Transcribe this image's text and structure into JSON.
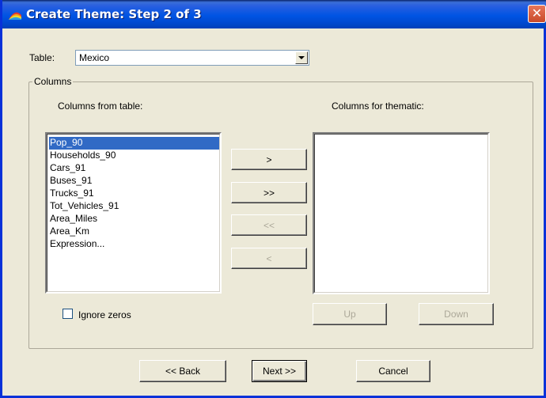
{
  "window": {
    "title": "Create Theme: Step 2 of 3",
    "close_symbol": "✕"
  },
  "table": {
    "label": "Table:",
    "selected": "Mexico"
  },
  "columns_group": {
    "title": "Columns",
    "from_label": "Columns from table:",
    "for_label": "Columns for thematic:",
    "from_items": [
      "Pop_90",
      "Households_90",
      "Cars_91",
      "Buses_91",
      "Trucks_91",
      "Tot_Vehicles_91",
      "Area_Miles",
      "Area_Km",
      "Expression..."
    ],
    "selected_item": "Pop_90",
    "for_items": []
  },
  "move_buttons": {
    "add": ">",
    "add_all": ">>",
    "remove_all": "<<",
    "remove": "<"
  },
  "ignore_zeros": {
    "label": "Ignore zeros",
    "checked": false
  },
  "order_buttons": {
    "up": "Up",
    "down": "Down"
  },
  "nav_buttons": {
    "back": "<< Back",
    "next": "Next >>",
    "cancel": "Cancel"
  },
  "colors": {
    "selection": "#316ac5",
    "titlebar": "#0054e3",
    "dialog": "#ece9d8"
  }
}
